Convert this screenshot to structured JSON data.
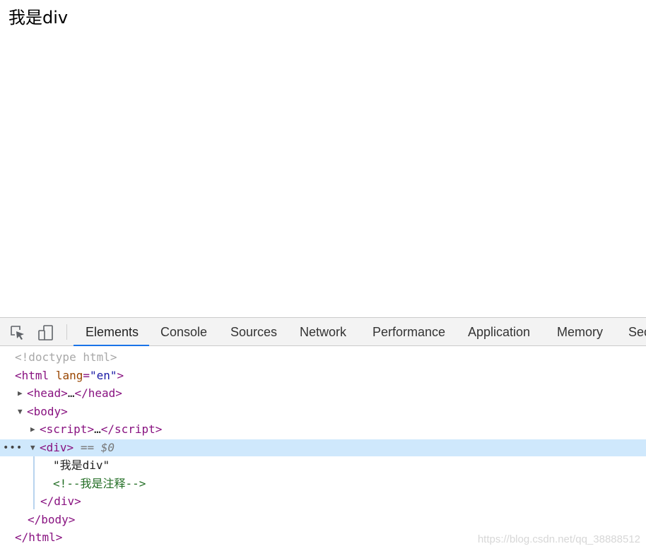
{
  "page": {
    "content_text": "我是div"
  },
  "devtools": {
    "toolbar": {
      "inspect_icon": "inspect-element-icon",
      "device_icon": "device-toggle-icon",
      "tabs": [
        {
          "label": "Elements",
          "active": true
        },
        {
          "label": "Console",
          "active": false
        },
        {
          "label": "Sources",
          "active": false
        },
        {
          "label": "Network",
          "active": false
        },
        {
          "label": "Performance",
          "active": false
        },
        {
          "label": "Application",
          "active": false
        },
        {
          "label": "Memory",
          "active": false
        },
        {
          "label": "Sec",
          "active": false
        }
      ],
      "accent_color": "#1a73e8"
    },
    "tree": {
      "doctype": "<!doctype html>",
      "html_open_tag": "html",
      "html_attr_name": "lang",
      "html_attr_value": "\"en\"",
      "head_tag": "head",
      "head_ellipsis": "…",
      "body_tag": "body",
      "script_tag": "script",
      "script_ellipsis": "…",
      "div_tag": "div",
      "div_selection_marker": "== $0",
      "div_text": "\"我是div\"",
      "div_comment": "<!--我是注释-->",
      "div_close": "div",
      "body_close": "body",
      "html_close": "html",
      "selected_color": "#cfe8fc"
    }
  },
  "watermark": "https://blog.csdn.net/qq_38888512"
}
